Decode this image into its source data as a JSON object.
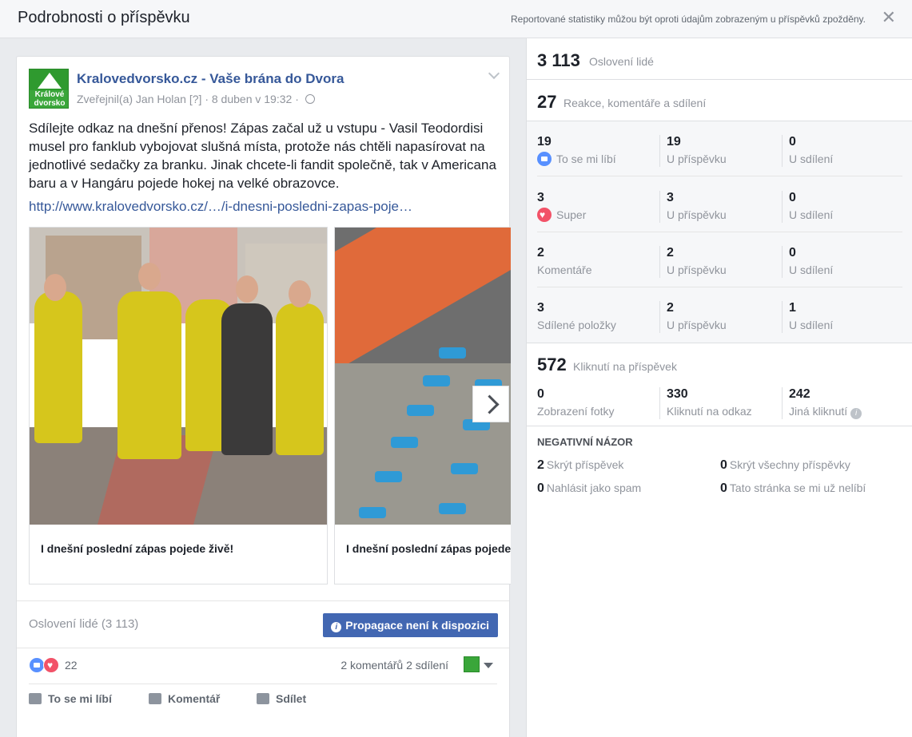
{
  "header": {
    "title": "Podrobnosti o příspěvku",
    "note": "Reportované statistiky můžou být oproti údajům zobrazeným u příspěvků zpožděny.",
    "close_glyph": "✕"
  },
  "post": {
    "page_name": "Kralovedvorsko.cz - Vaše brána do Dvora",
    "avatar_text": "Králové dvorsko",
    "meta_author": "Zveřejnil(a) Jan Holan",
    "meta_qmark": "[?]",
    "meta_date": "8 duben v 19:32",
    "text": "Sdílejte odkaz na dnešní přenos! Zápas začal už u vstupu - Vasil Teodordisi musel pro fanklub vybojovat slušná místa, protože nás chtěli napasírovat na jednotlivé sedačky za branku. Jinak chcete-li fandit společně, tak v Americana baru a v Hangáru pojede hokej na velké obrazovce.",
    "link": "http://www.kralovedvorsko.cz/…/i-dnesni-posledni-zapas-poje…",
    "slides": [
      {
        "caption": "I dnešní poslední zápas pojede živě!"
      },
      {
        "caption": "I dnešní poslední zápas pojede živě!"
      }
    ],
    "reach_label": "Oslovení lidé (3 113)",
    "promo_button": "Propagace není k dispozici",
    "reactions_count": "22",
    "comments_shares": "2 komentářů  2 sdílení",
    "actions": {
      "like": "To se mi líbí",
      "comment": "Komentář",
      "share": "Sdílet"
    }
  },
  "stats": {
    "reach": {
      "value": "3 113",
      "label": "Oslovení lidé"
    },
    "engagement": {
      "value": "27",
      "label": "Reakce, komentáře a sdílení"
    },
    "breakdown": [
      {
        "value": "19",
        "label": "To se mi líbí",
        "icon": "like-reaction-icon",
        "post_value": "19",
        "post_label": "U příspěvku",
        "share_value": "0",
        "share_label": "U sdílení"
      },
      {
        "value": "3",
        "label": "Super",
        "icon": "love-reaction-icon",
        "post_value": "3",
        "post_label": "U příspěvku",
        "share_value": "0",
        "share_label": "U sdílení"
      },
      {
        "value": "2",
        "label": "Komentáře",
        "post_value": "2",
        "post_label": "U příspěvku",
        "share_value": "0",
        "share_label": "U sdílení"
      },
      {
        "value": "3",
        "label": "Sdílené položky",
        "post_value": "2",
        "post_label": "U příspěvku",
        "share_value": "1",
        "share_label": "U sdílení"
      }
    ],
    "clicks": {
      "value": "572",
      "label": "Kliknutí na příspěvek",
      "photo_views": {
        "value": "0",
        "label": "Zobrazení fotky"
      },
      "link_clicks": {
        "value": "330",
        "label": "Kliknutí na odkaz"
      },
      "other_clicks": {
        "value": "242",
        "label": "Jiná kliknutí"
      }
    },
    "negative": {
      "title": "NEGATIVNÍ NÁZOR",
      "hide_post": {
        "value": "2",
        "label": "Skrýt příspěvek"
      },
      "hide_all": {
        "value": "0",
        "label": "Skrýt všechny příspěvky"
      },
      "spam": {
        "value": "0",
        "label": "Nahlásit jako spam"
      },
      "unlike": {
        "value": "0",
        "label": "Tato stránka se mi už nelíbí"
      }
    }
  },
  "colors": {
    "link": "#365899",
    "button": "#4267b2",
    "like": "#5890ff",
    "love": "#f25268",
    "brand_green": "#3aa63a"
  }
}
